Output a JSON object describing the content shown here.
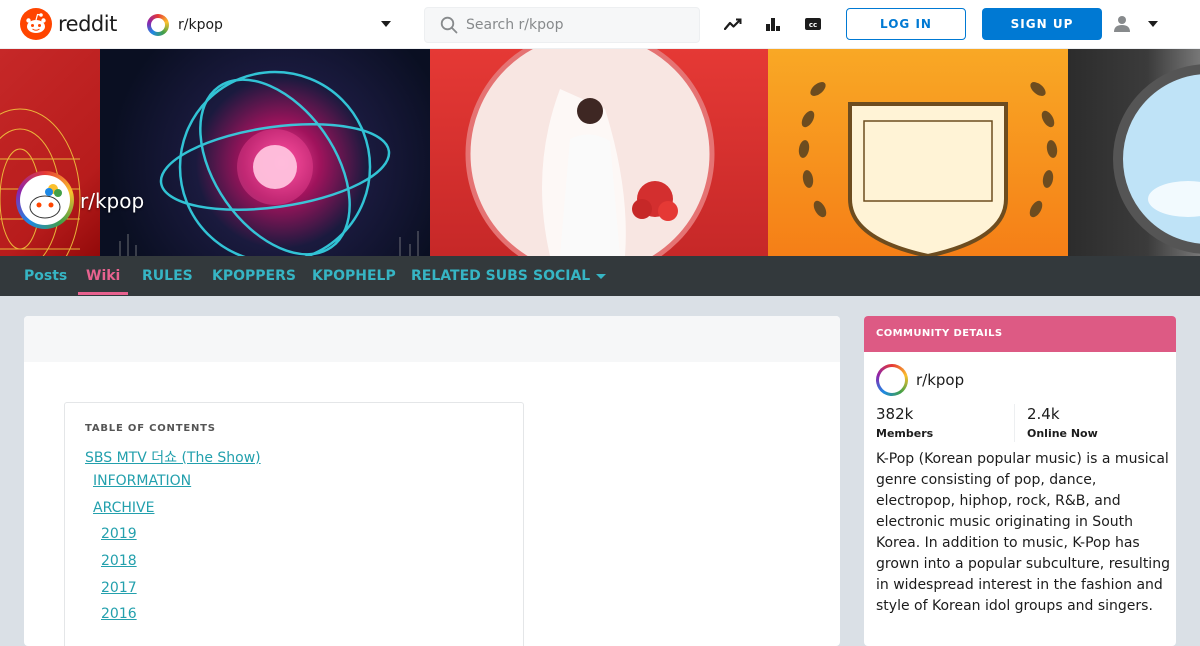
{
  "header": {
    "brand": "reddit",
    "subreddit_switcher": "r/kpop",
    "search_placeholder": "Search r/kpop",
    "login_label": "LOG IN",
    "signup_label": "SIGN UP",
    "icons": [
      "trending-icon",
      "leaderboard-icon",
      "closed-captions-icon",
      "user-icon"
    ]
  },
  "banner": {
    "subreddit_name": "r/kpop"
  },
  "nav": {
    "items": [
      {
        "label": "Posts"
      },
      {
        "label": "Wiki",
        "active": true
      },
      {
        "label": "RULES"
      },
      {
        "label": "KPOPPERS"
      },
      {
        "label": "KPOPHELP"
      },
      {
        "label": "RELATED SUBS"
      },
      {
        "label": "SOCIAL",
        "has_dropdown": true
      }
    ]
  },
  "toc": {
    "title": "TABLE OF CONTENTS",
    "links": [
      {
        "label": "SBS MTV 더쇼 (The Show)",
        "level": 0
      },
      {
        "label": "INFORMATION",
        "level": 1
      },
      {
        "label": "ARCHIVE",
        "level": 1
      },
      {
        "label": "2019",
        "level": 2
      },
      {
        "label": "2018",
        "level": 2
      },
      {
        "label": "2017",
        "level": 2
      },
      {
        "label": "2016",
        "level": 2
      }
    ]
  },
  "sidebar": {
    "header": "COMMUNITY DETAILS",
    "name": "r/kpop",
    "members_value": "382k",
    "members_label": "Members",
    "online_value": "2.4k",
    "online_label": "Online Now",
    "description": "K-Pop (Korean popular music) is a musical genre consisting of pop, dance, electropop, hiphop, rock, R&B, and electronic music originating in South Korea. In addition to music, K-Pop has grown into a popular subculture, resulting in widespread interest in the fashion and style of Korean idol groups and singers."
  },
  "colors": {
    "reddit_orange": "#ff4500",
    "reddit_blue": "#0079d3",
    "nav_bg": "#33393c",
    "nav_link": "#36b5c4",
    "nav_active": "#e8628f",
    "sidebar_header": "#dd5a84",
    "toc_link": "#23a0ad"
  }
}
